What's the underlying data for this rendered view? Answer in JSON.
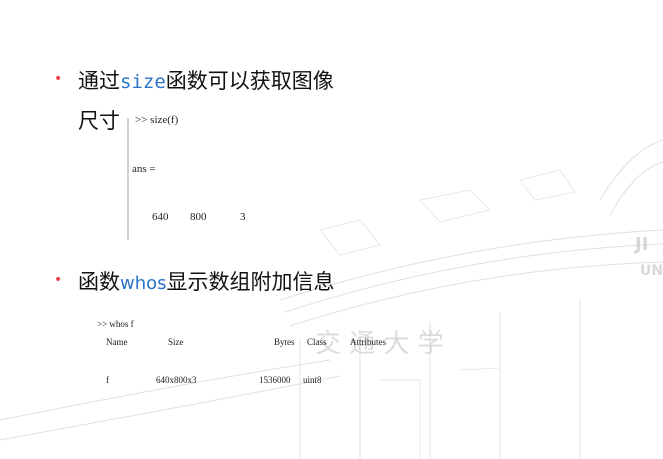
{
  "bullet1": {
    "prefix": "通过",
    "keyword": "size",
    "suffix": "函数可以获取图像",
    "line2": "尺寸"
  },
  "size_output": {
    "command": ">> size(f)",
    "ans_label": "ans =",
    "values": [
      "640",
      "800",
      "3"
    ]
  },
  "bullet2": {
    "prefix": "函数",
    "keyword": "whos",
    "suffix": "显示数组附加信息"
  },
  "whos_output": {
    "command": ">> whos f",
    "headers": [
      "Name",
      "Size",
      "Bytes",
      "Class",
      "Attributes"
    ],
    "row": [
      "f",
      "640x800x3",
      "1536000",
      "uint8",
      ""
    ]
  },
  "watermark_text": "交 通 大 学",
  "colors": {
    "bullet": "#e8404a",
    "keyword": "#2a73c8",
    "text": "#111111"
  }
}
